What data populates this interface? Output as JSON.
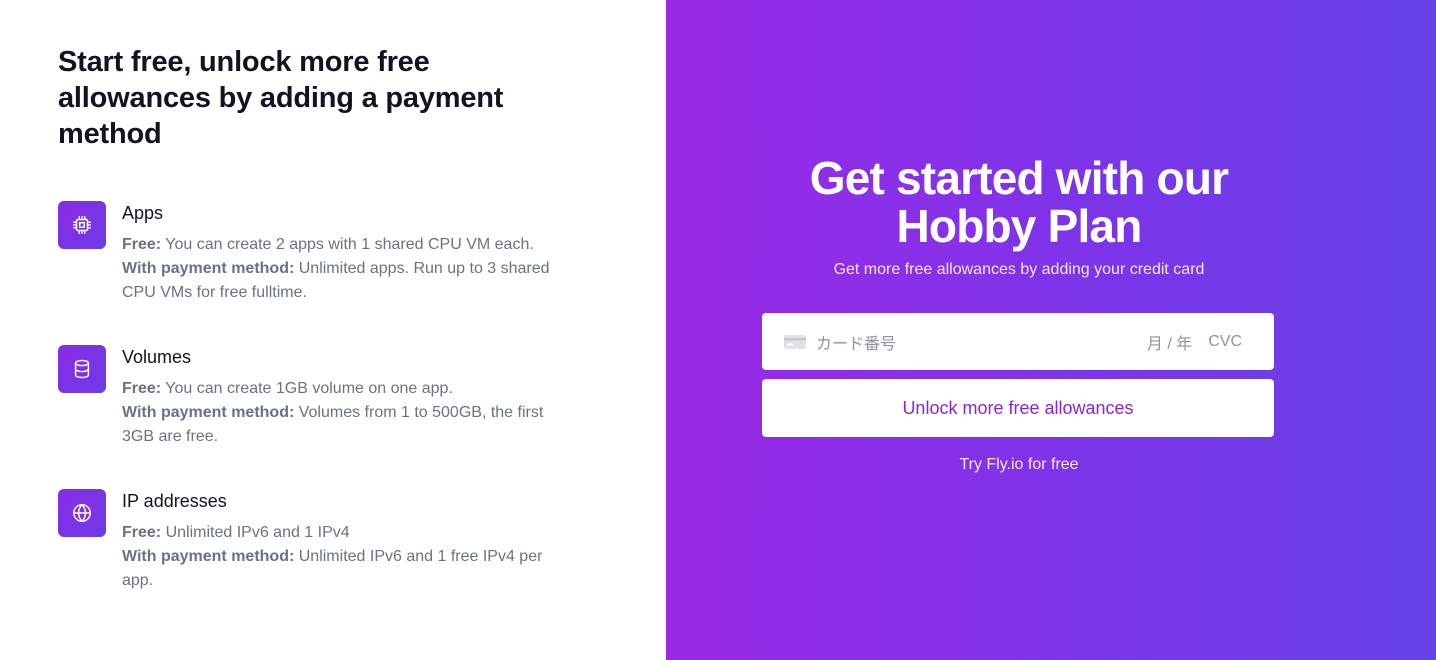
{
  "left": {
    "heading": "Start free, unlock more free allowances by adding a payment method",
    "features": [
      {
        "title": "Apps",
        "icon": "cpu-icon",
        "free_label": "Free:",
        "free_text": " You can create 2 apps with 1 shared CPU VM each.",
        "paid_label": "With payment method:",
        "paid_text": " Unlimited apps. Run up to 3 shared CPU VMs for free fulltime."
      },
      {
        "title": "Volumes",
        "icon": "database-icon",
        "free_label": "Free:",
        "free_text": " You can create 1GB volume on one app.",
        "paid_label": "With payment method:",
        "paid_text": " Volumes from 1 to 500GB, the first 3GB are free."
      },
      {
        "title": "IP addresses",
        "icon": "globe-icon",
        "free_label": "Free:",
        "free_text": " Unlimited IPv6 and 1 IPv4",
        "paid_label": "With payment method:",
        "paid_text": " Unlimited IPv6 and 1 free IPv4 per app."
      }
    ]
  },
  "right": {
    "title_line1": "Get started with our",
    "title_line2": "Hobby Plan",
    "subtitle": "Get more free allowances by adding your credit card",
    "card": {
      "number_placeholder": "カード番号",
      "expiry_placeholder": "月 / 年",
      "cvc_placeholder": "CVC"
    },
    "unlock_button": "Unlock more free allowances",
    "try_link": "Try Fly.io for free"
  },
  "colors": {
    "accent_start": "#9a2ae6",
    "accent_end": "#6743e8",
    "button_text": "#8a24d6",
    "heading": "#111322",
    "body_text": "#6b7186"
  }
}
